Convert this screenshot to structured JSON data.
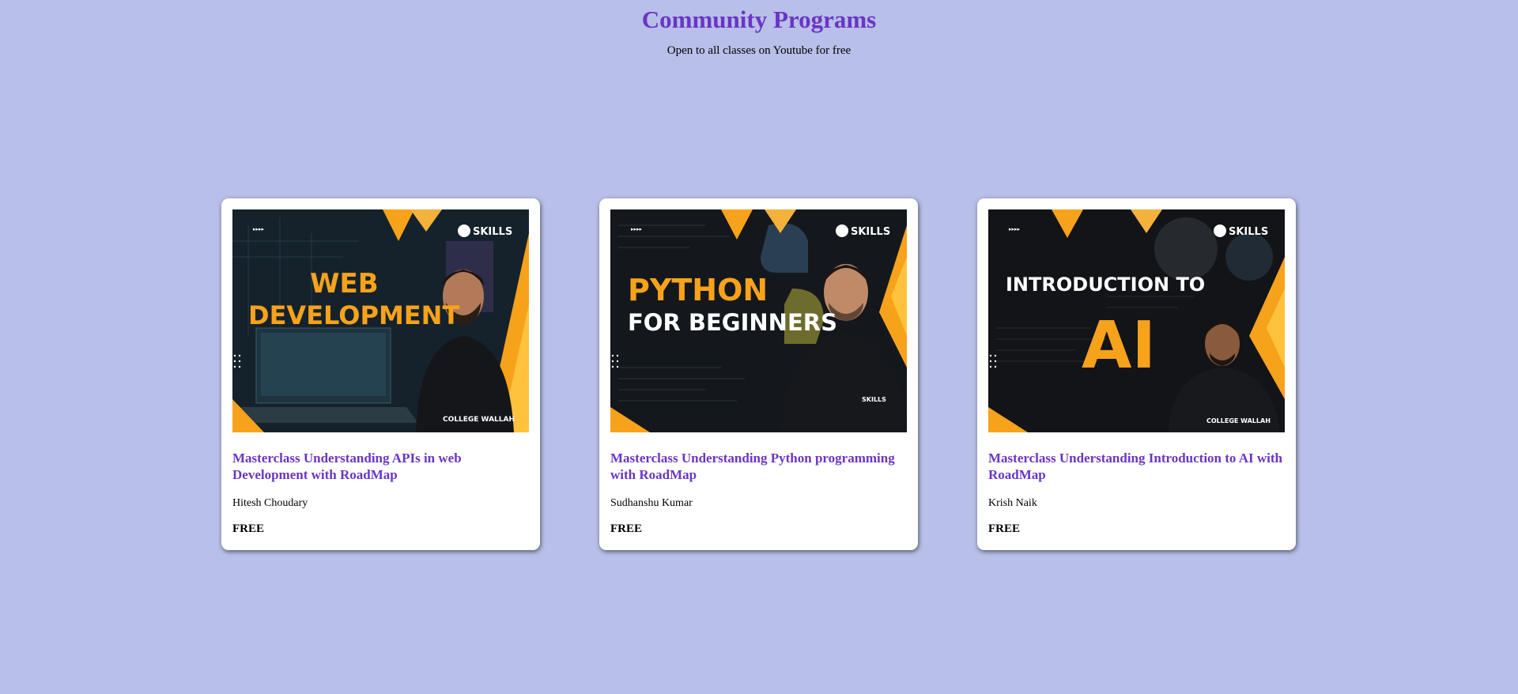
{
  "header": {
    "title": "Community Programs",
    "subtitle": "Open to all classes on Youtube for free"
  },
  "colors": {
    "background": "#b8bfe9",
    "accent": "#6a35c6",
    "thumb_orange": "#f7a21b"
  },
  "courses": [
    {
      "thumbnail": {
        "brand": "SKILLS",
        "headline_line1": "WEB",
        "headline_line2": "DEVELOPMENT",
        "shirt_text": "COLLEGE WALLAH"
      },
      "title": "Masterclass Understanding APIs in web Development with RoadMap",
      "instructor": "Hitesh Choudary",
      "price": "FREE"
    },
    {
      "thumbnail": {
        "brand": "SKILLS",
        "headline_line1": "PYTHON",
        "headline_line2": "FOR BEGINNERS",
        "shirt_text": "SKILLS"
      },
      "title": "Masterclass Understanding Python programming with RoadMap",
      "instructor": "Sudhanshu Kumar",
      "price": "FREE"
    },
    {
      "thumbnail": {
        "brand": "SKILLS",
        "headline_line1": "INTRODUCTION TO",
        "headline_line2": "AI",
        "shirt_text": "COLLEGE WALLAH"
      },
      "title": "Masterclass Understanding Introduction to AI with RoadMap",
      "instructor": "Krish Naik",
      "price": "FREE"
    }
  ]
}
